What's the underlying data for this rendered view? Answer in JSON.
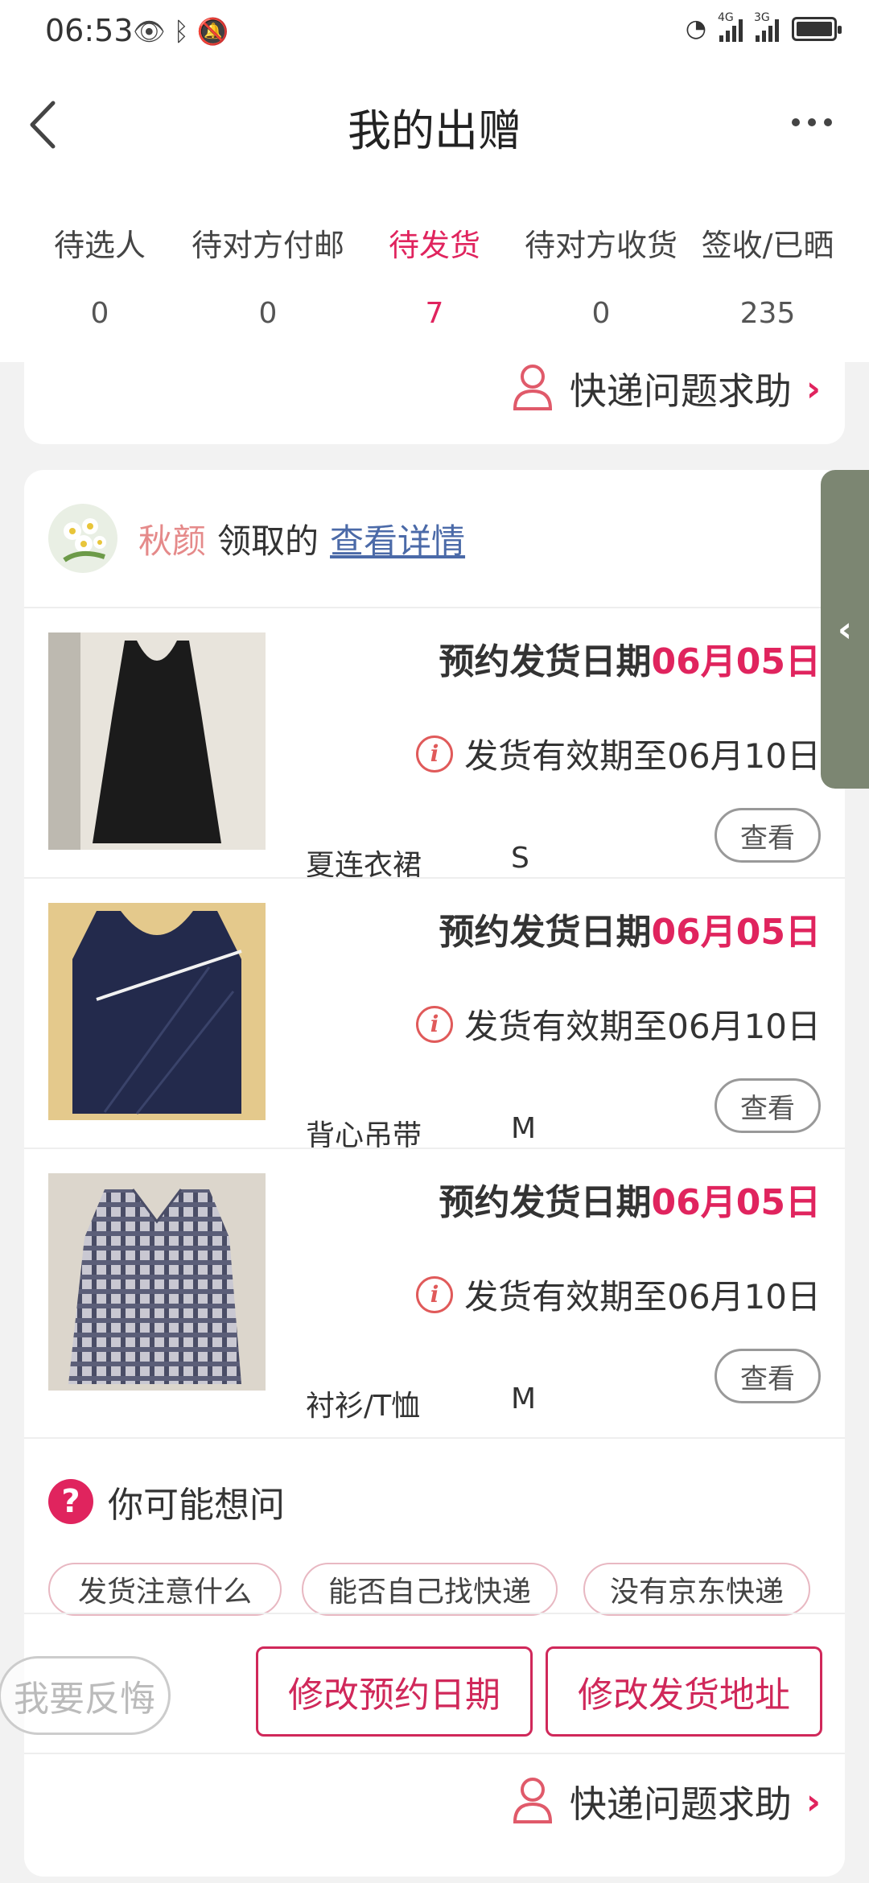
{
  "status_bar": {
    "time": "06:53",
    "left_icons": [
      "eye-icon",
      "bluetooth-icon",
      "bell-muted-icon"
    ],
    "signal_labels": [
      "4G",
      "3G"
    ]
  },
  "header": {
    "title": "我的出赠",
    "back_icon": "chevron-left-icon",
    "more_icon": "more-dots-icon"
  },
  "tabs": [
    {
      "label": "待选人",
      "count": "0"
    },
    {
      "label": "待对方付邮",
      "count": "0"
    },
    {
      "label": "待发货",
      "count": "7",
      "active": true
    },
    {
      "label": "待对方收货",
      "count": "0"
    },
    {
      "label": "签收/已晒",
      "count": "235"
    }
  ],
  "help_label": "快递问题求助",
  "donation": {
    "donor_name": "秋颜",
    "action_text": "领取的",
    "detail_link": "查看详情",
    "items": [
      {
        "date_prefix": "预约发货日期",
        "date_value": "06月05日",
        "validity": "发货有效期至06月10日",
        "name": "夏连衣裙",
        "size": "S",
        "view_label": "查看"
      },
      {
        "date_prefix": "预约发货日期",
        "date_value": "06月05日",
        "validity": "发货有效期至06月10日",
        "name": "背心吊带",
        "size": "M",
        "view_label": "查看"
      },
      {
        "date_prefix": "预约发货日期",
        "date_value": "06月05日",
        "validity": "发货有效期至06月10日",
        "name": "衬衫/T恤",
        "size": "M",
        "view_label": "查看"
      }
    ],
    "faq": {
      "title": "你可能想问",
      "chips": [
        "发货注意什么",
        "能否自己找快递",
        "没有京东快递"
      ]
    },
    "actions": {
      "change_date": "修改预约日期",
      "change_address": "修改发货地址"
    }
  },
  "regret_label": "我要反悔",
  "colors": {
    "accent": "#e0245e",
    "donor_name": "#e58a8a",
    "link": "#4b6aa8",
    "side_tab": "#7c8672"
  }
}
